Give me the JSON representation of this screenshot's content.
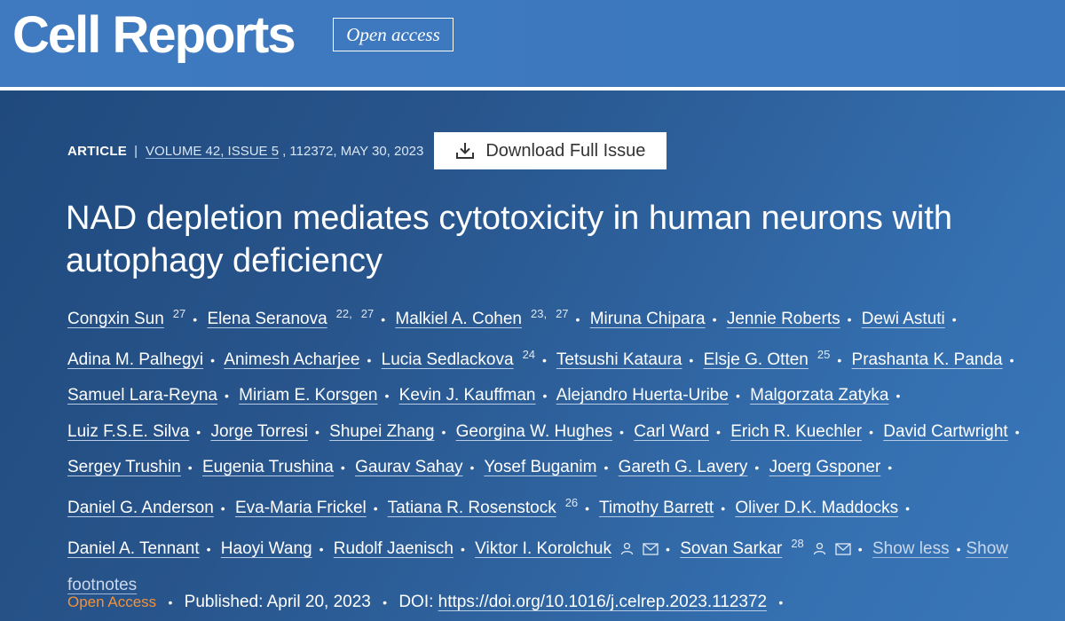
{
  "header": {
    "journal": "Cell Reports",
    "badge": "Open access"
  },
  "meta": {
    "article_type": "ARTICLE",
    "separator": "|",
    "issue_link": "VOLUME 42, ISSUE 5",
    "issue_rest": ", 112372, MAY 30, 2023",
    "download_label": "Download Full Issue"
  },
  "title": "NAD depletion mediates cytotoxicity in human neurons with autophagy deficiency",
  "authors": [
    {
      "name": "Congxin Sun",
      "sup": "27"
    },
    {
      "name": "Elena Seranova",
      "sup": "22, 27"
    },
    {
      "name": "Malkiel A. Cohen",
      "sup": "23, 27"
    },
    {
      "name": "Miruna Chipara"
    },
    {
      "name": "Jennie Roberts"
    },
    {
      "name": "Dewi Astuti"
    },
    {
      "name": "Adina M. Palhegyi"
    },
    {
      "name": "Animesh Acharjee"
    },
    {
      "name": "Lucia Sedlackova",
      "sup": "24"
    },
    {
      "name": "Tetsushi Kataura"
    },
    {
      "name": "Elsje G. Otten",
      "sup": "25"
    },
    {
      "name": "Prashanta K. Panda"
    },
    {
      "name": "Samuel Lara-Reyna"
    },
    {
      "name": "Miriam E. Korsgen"
    },
    {
      "name": "Kevin J. Kauffman"
    },
    {
      "name": "Alejandro Huerta-Uribe"
    },
    {
      "name": "Malgorzata Zatyka"
    },
    {
      "name": "Luiz F.S.E. Silva"
    },
    {
      "name": "Jorge Torresi"
    },
    {
      "name": "Shupei Zhang"
    },
    {
      "name": "Georgina W. Hughes"
    },
    {
      "name": "Carl Ward"
    },
    {
      "name": "Erich R. Kuechler"
    },
    {
      "name": "David Cartwright"
    },
    {
      "name": "Sergey Trushin"
    },
    {
      "name": "Eugenia Trushina"
    },
    {
      "name": "Gaurav Sahay"
    },
    {
      "name": "Yosef Buganim"
    },
    {
      "name": "Gareth G. Lavery"
    },
    {
      "name": "Joerg Gsponer"
    },
    {
      "name": "Daniel G. Anderson"
    },
    {
      "name": "Eva-Maria Frickel"
    },
    {
      "name": "Tatiana R. Rosenstock",
      "sup": "26"
    },
    {
      "name": "Timothy Barrett"
    },
    {
      "name": "Oliver D.K. Maddocks"
    },
    {
      "name": "Daniel A. Tennant"
    },
    {
      "name": "Haoyi Wang"
    },
    {
      "name": "Rudolf Jaenisch"
    },
    {
      "name": "Viktor I. Korolchuk",
      "icons": [
        "person-icon",
        "mail-icon"
      ]
    },
    {
      "name": "Sovan Sarkar",
      "sup": "28",
      "icons": [
        "person-icon",
        "mail-icon"
      ]
    }
  ],
  "author_links": {
    "show_less": "Show less",
    "show_footnotes": "Show footnotes"
  },
  "footer": {
    "open_access": "Open Access",
    "published": "Published: April 20, 2023",
    "doi_label": "DOI:",
    "doi": "https://doi.org/10.1016/j.celrep.2023.112372"
  },
  "colors": {
    "header_blue": "#3b77bd",
    "hero_dark": "#1f4a7e",
    "hero_light": "#3977b9",
    "open_access_orange": "#f2923a"
  }
}
